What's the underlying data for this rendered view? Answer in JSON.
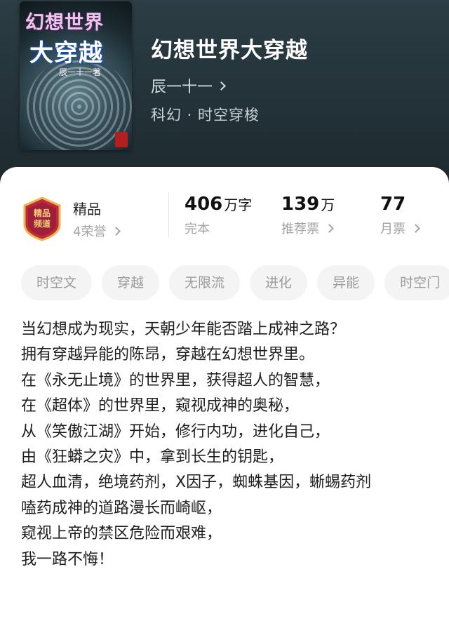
{
  "cover": {
    "title_line1": "幻想世界",
    "title_line2": "大穿越",
    "author_text": "辰一十一著"
  },
  "book": {
    "title": "幻想世界大穿越",
    "author": "辰一十一",
    "category": "科幻 · 时空穿梭"
  },
  "badge_panel": {
    "badge_text": "精品频道",
    "quality_label": "精品",
    "honor_count": "4荣誉"
  },
  "stats": [
    {
      "value": "406",
      "unit": "万字",
      "label": "完本"
    },
    {
      "value": "139",
      "unit": "万",
      "label": "推荐票"
    },
    {
      "value": "77",
      "unit": "",
      "label": "月票"
    }
  ],
  "tags": [
    "时空文",
    "穿越",
    "无限流",
    "进化",
    "异能",
    "时空门"
  ],
  "description": [
    "当幻想成为现实，天朝少年能否踏上成神之路？",
    "拥有穿越异能的陈昂，穿越在幻想世界里。",
    "在《永无止境》的世界里，获得超人的智慧，",
    "在《超体》的世界里，窥视成神的奥秘，",
    "从《笑傲江湖》开始，修行内功，进化自己，",
    "由《狂蟒之灾》中，拿到长生的钥匙，",
    "超人血清，绝境药剂，X因子，蜘蛛基因，蜥蜴药剂",
    "嗑药成神的道路漫长而崎岖，",
    "窥视上帝的禁区危险而艰难，",
    "我一路不悔！"
  ],
  "colors": {
    "header_bg": "#233238",
    "badge_red": "#c0283b",
    "badge_gold": "#e8b64a",
    "muted": "#a3a3a3"
  }
}
